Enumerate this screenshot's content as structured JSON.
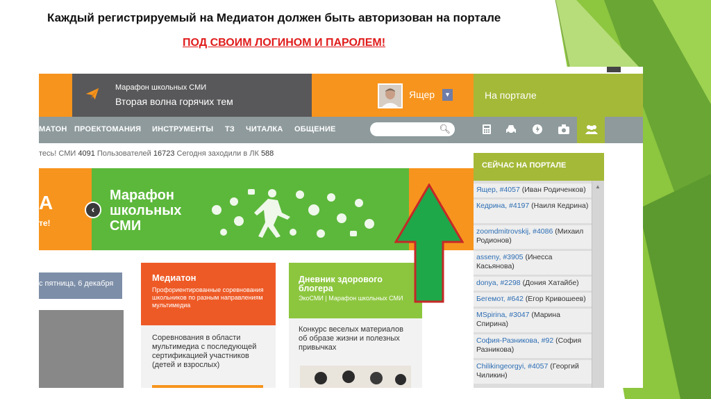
{
  "slide": {
    "title": "Каждый регистрируемый на Медиатон должен быть авторизован на портале",
    "subtitle": "ПОД СВОИМ ЛОГИНОМ И ПАРОЛЕМ!"
  },
  "header": {
    "brand_line1": "Марафон школьных СМИ",
    "brand_line2": "Вторая волна горячих тем",
    "user_name": "Ящер",
    "portal_label": "На портале"
  },
  "nav": {
    "items": [
      "МАТОН",
      "ПРОЕКТОМАНИЯ",
      "ИНСТРУМЕНТЫ",
      "ТЗ",
      "ЧИТАЛКА",
      "ОБЩЕНИЕ"
    ],
    "search_placeholder": "",
    "icons": [
      "calculator-icon",
      "car-icon",
      "idea-icon",
      "camera-icon",
      "people-icon"
    ]
  },
  "stats": {
    "prefix": "тесь!",
    "smi_label": "СМИ",
    "smi_count": "4091",
    "users_label": "Пользователей",
    "users_count": "16723",
    "today_label": "Сегодня заходили в ЛК",
    "today_count": "588"
  },
  "banner": {
    "left_letter": "А",
    "left_text": "те!",
    "title": "Марафон школьных СМИ"
  },
  "date_plate": "с пятница, 6 декабря",
  "cards": [
    {
      "title": "Медиатон",
      "subtitle": "Профориентированные соревнования школьников по разным направлениям мультимедиа",
      "text": "Соревнования в области мультимедиа с последующей сертификацией участников (детей и взрослых)",
      "color": "#ee5a26"
    },
    {
      "title": "Дневник здорового блогера",
      "subtitle": "ЭкоСМИ | Марафон школьных СМИ",
      "text": "Конкурс веселых материалов об образе жизни и полезных привычках",
      "color": "#8cc63e"
    }
  ],
  "portal_now": {
    "heading": "СЕЙЧАС НА ПОРТАЛЕ",
    "users": [
      {
        "login": "Ящер, #4057",
        "name": "(Иван Родиченков)"
      },
      {
        "login": "Кедрина, #4197",
        "name": "(Наиля Кедрина)"
      },
      {
        "login": "zoomdmitrovskij, #4086",
        "name": "(Михаил Родионов)"
      },
      {
        "login": "asseny, #3905",
        "name": "(Инесса Касьянова)"
      },
      {
        "login": "donya, #2298",
        "name": "(Дония Хатайбе)"
      },
      {
        "login": "Бегемот, #642",
        "name": "(Егор Кривошеев)"
      },
      {
        "login": "MSpirina, #3047",
        "name": "(Марина Спирина)"
      },
      {
        "login": "София-Разникова, #92",
        "name": "(София Разникова)"
      },
      {
        "login": "Chilikingeorgyi, #4057",
        "name": "(Георгий Чиликин)"
      }
    ]
  },
  "colors": {
    "orange": "#f7941d",
    "green": "#a5b938",
    "banner_green": "#5cb83b",
    "arrow_green": "#1fa84a",
    "arrow_border": "#c62828",
    "nav_gray": "#8e9a9c",
    "header_gray": "#58585a"
  }
}
